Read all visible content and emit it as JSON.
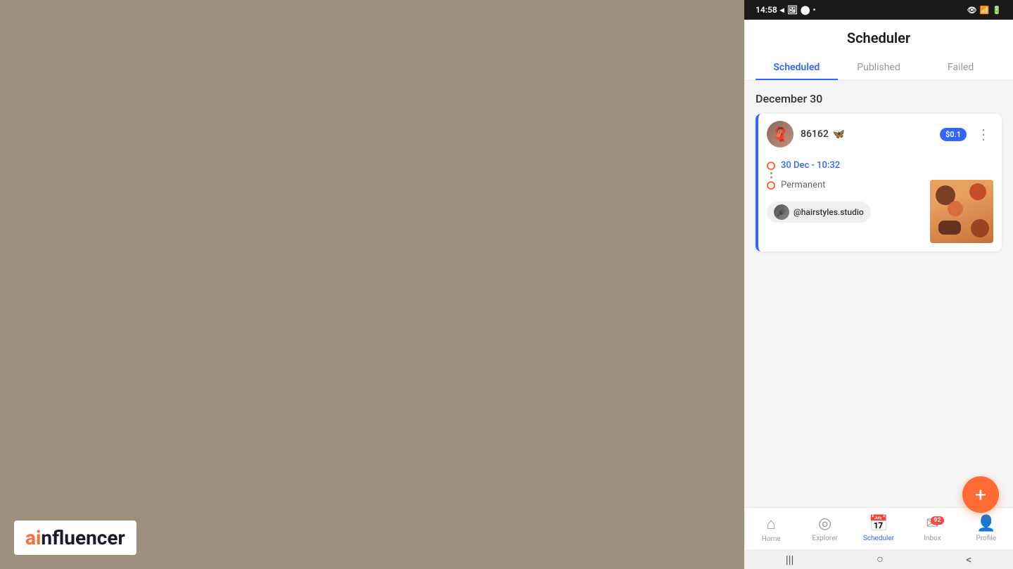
{
  "background": {
    "color": "#9e8e7e"
  },
  "watermark": {
    "ai": "ai",
    "rest": "nfluencer"
  },
  "status_bar": {
    "time": "14:58",
    "icons": "◂ 🖼 ⬤ •"
  },
  "app": {
    "title": "Scheduler",
    "tabs": [
      {
        "id": "scheduled",
        "label": "Scheduled",
        "active": true
      },
      {
        "id": "published",
        "label": "Published",
        "active": false
      },
      {
        "id": "failed",
        "label": "Failed",
        "active": false
      }
    ]
  },
  "content": {
    "section_date": "December 30",
    "post": {
      "username": "86162",
      "price": "$0.1",
      "time": "30 Dec - 10:32",
      "repeat": "Permanent",
      "account": "@hairstyles.studio"
    }
  },
  "fab": {
    "label": "+"
  },
  "bottom_nav": [
    {
      "id": "home",
      "label": "Home",
      "icon": "⌂",
      "active": false,
      "badge": null
    },
    {
      "id": "explorer",
      "label": "Explorer",
      "icon": "◎",
      "active": false,
      "badge": null
    },
    {
      "id": "scheduler",
      "label": "Scheduler",
      "icon": "📅",
      "active": true,
      "badge": null
    },
    {
      "id": "inbox",
      "label": "Inbox",
      "icon": "✉",
      "active": false,
      "badge": "92"
    },
    {
      "id": "profile",
      "label": "Profile",
      "icon": "👤",
      "active": false,
      "badge": null
    }
  ],
  "android_bar": {
    "menu": "|||",
    "home": "○",
    "back": "<"
  }
}
